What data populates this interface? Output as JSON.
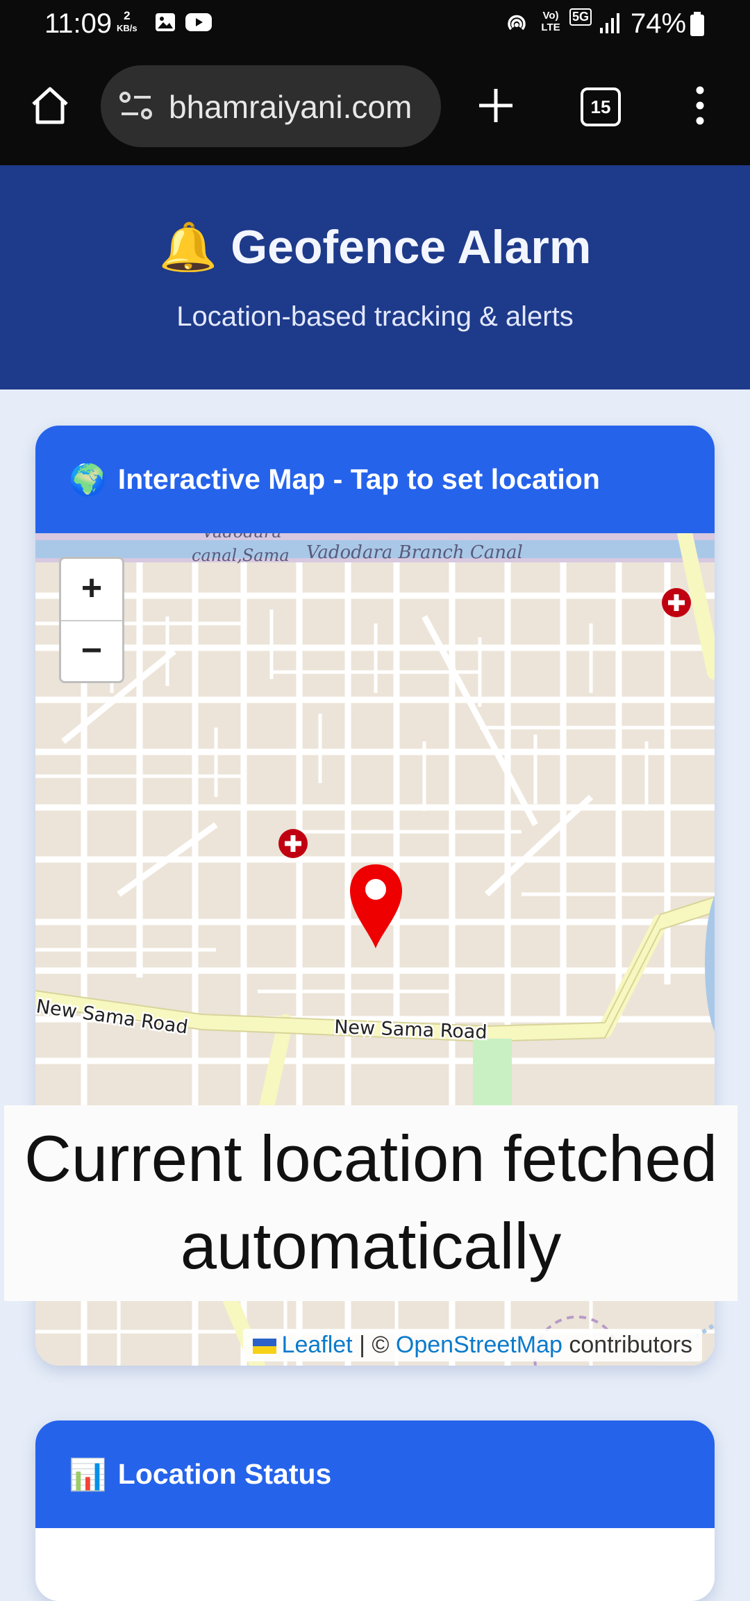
{
  "status_bar": {
    "time": "11:09",
    "speed_value": "2",
    "speed_unit": "KB/s",
    "battery": "74%",
    "network_label": "Vo) LTE",
    "network_5g": "5G"
  },
  "browser": {
    "url": "bhamraiyani.com",
    "tab_count": "15"
  },
  "header": {
    "emoji": "🔔",
    "title": "Geofence Alarm",
    "subtitle": "Location-based tracking & alerts"
  },
  "map_card": {
    "emoji": "🌍",
    "title": "Interactive Map - Tap to set location",
    "zoom_in": "+",
    "zoom_out": "−",
    "labels": {
      "canal_1": "Vadodara",
      "canal_2": "canal,Sama",
      "canal_3": "Vadodara Branch Canal",
      "road_1": "New Sama Road",
      "road_2": "New Sama Road"
    },
    "attribution": {
      "leaflet": "Leaflet",
      "separator": "| ©",
      "osm": "OpenStreetMap",
      "contributors": "contributors"
    },
    "colors": {
      "header": "#2563eb",
      "marker": "#ee0000"
    }
  },
  "caption": {
    "line1": "Current location fetched",
    "line2": "automatically"
  },
  "status_card": {
    "emoji": "📊",
    "title": "Location Status"
  },
  "colors": {
    "hero": "#1e3a8a",
    "page_bg": "#e6edf8"
  }
}
